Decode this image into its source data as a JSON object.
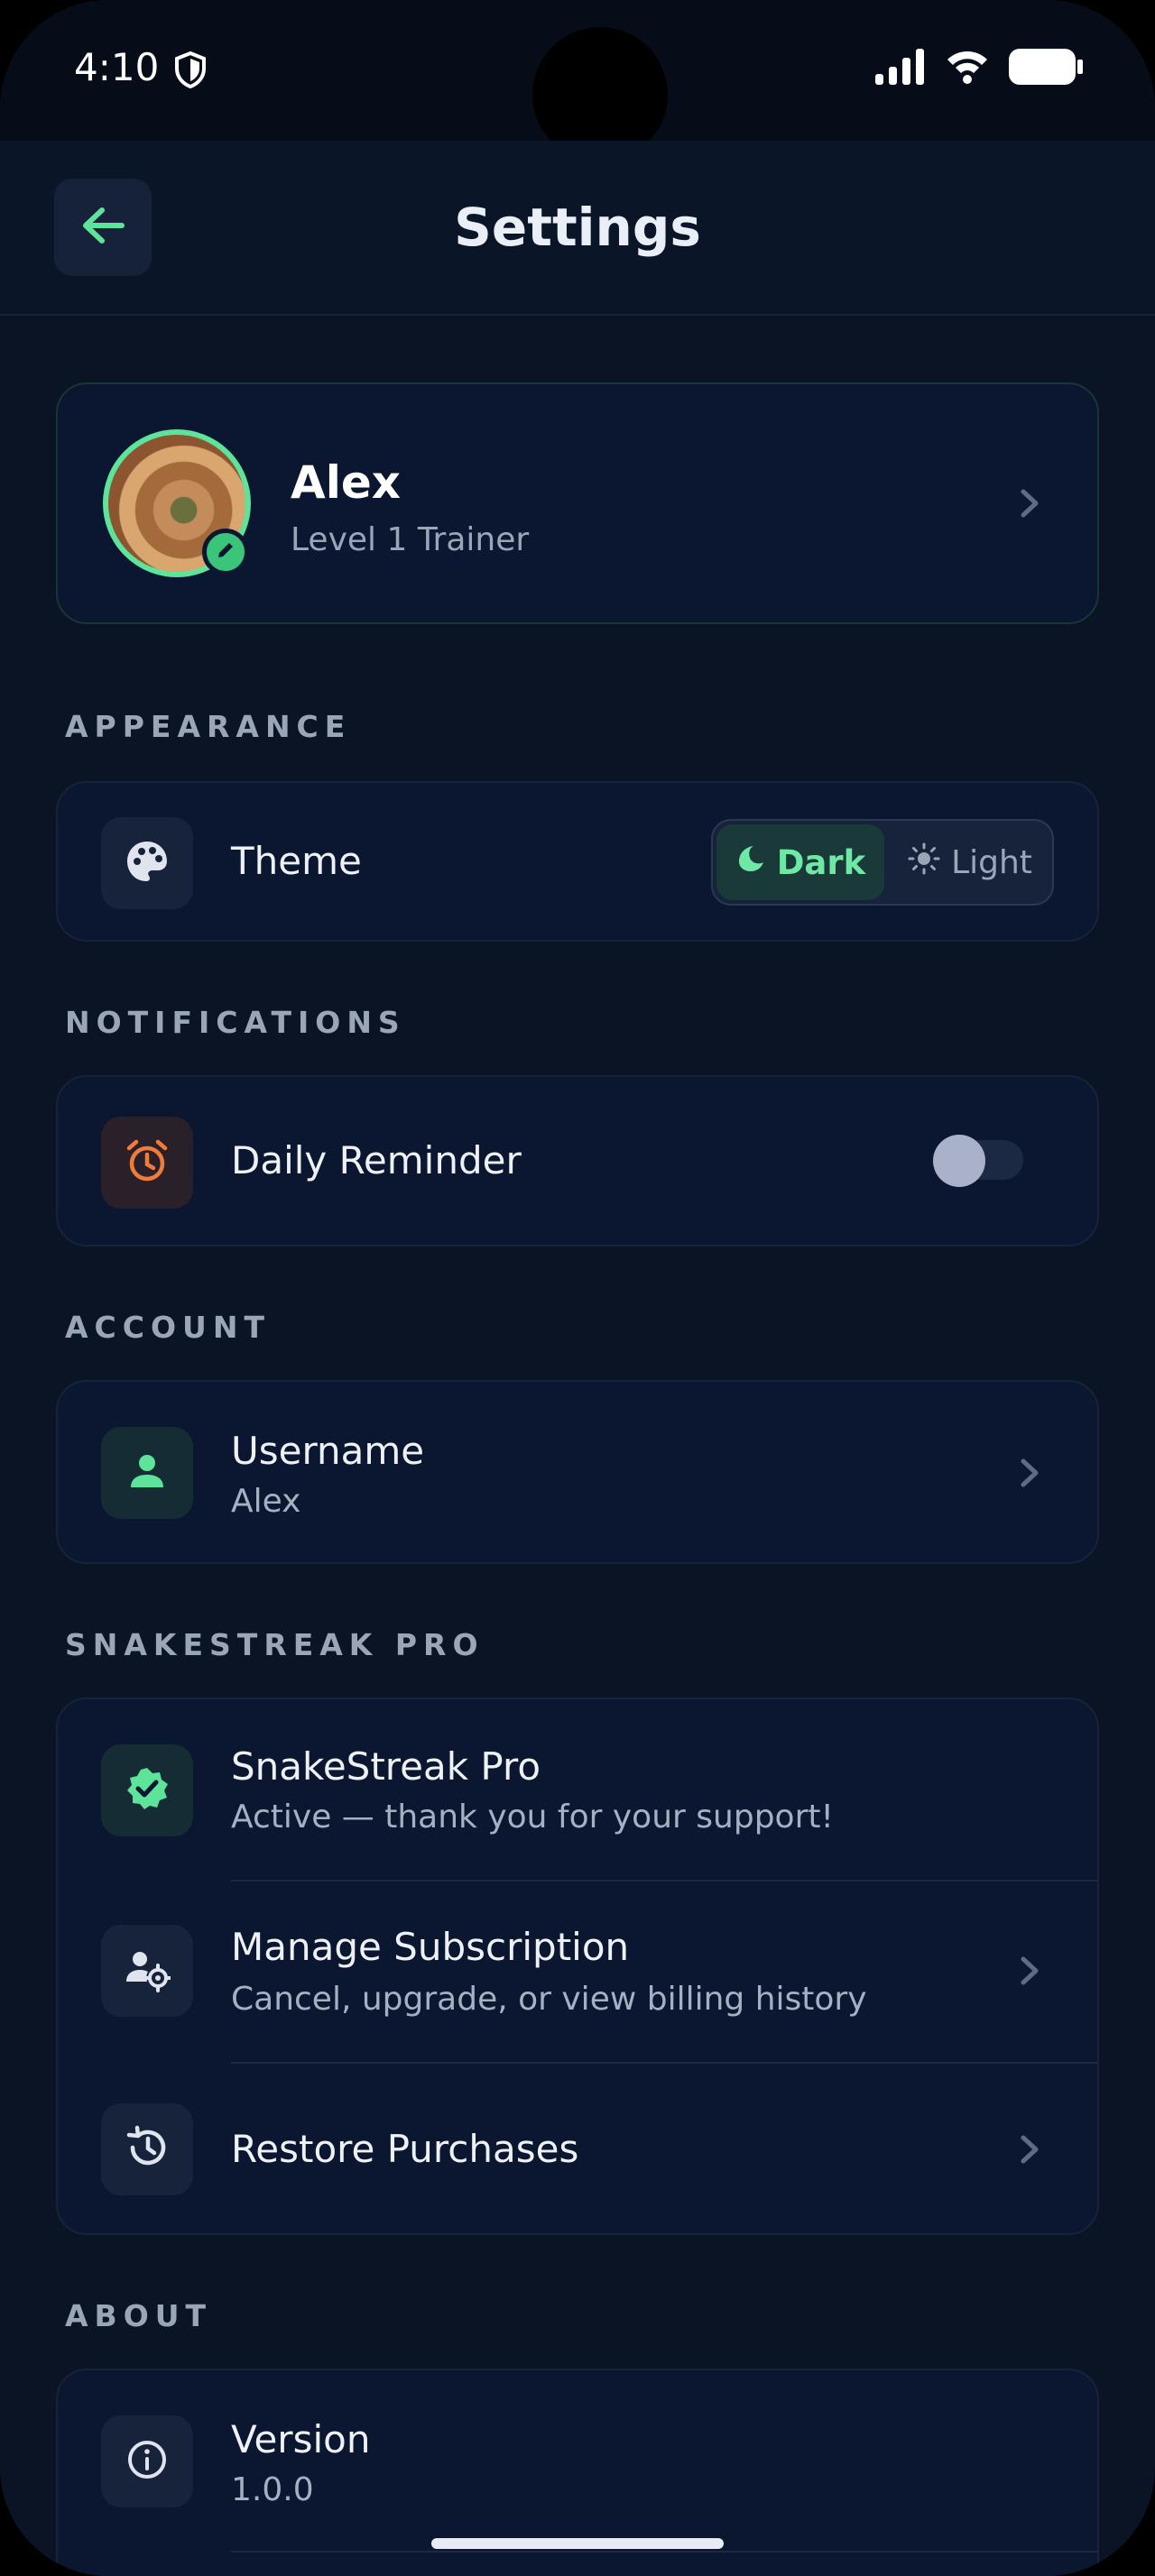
{
  "status_bar": {
    "time": "4:10"
  },
  "app_bar": {
    "title": "Settings"
  },
  "profile": {
    "name": "Alex",
    "level": "Level 1 Trainer"
  },
  "sections": {
    "appearance": "APPEARANCE",
    "notifications": "NOTIFICATIONS",
    "account": "ACCOUNT",
    "pro": "SNAKESTREAK PRO",
    "about": "ABOUT"
  },
  "appearance": {
    "theme_label": "Theme",
    "options": {
      "dark": "Dark",
      "light": "Light"
    },
    "selected": "Dark"
  },
  "notifications": {
    "daily_reminder_label": "Daily Reminder",
    "daily_reminder_on": false
  },
  "account": {
    "username_label": "Username",
    "username_value": "Alex"
  },
  "pro": {
    "status_title": "SnakeStreak Pro",
    "status_sub": "Active — thank you for your support!",
    "manage_title": "Manage Subscription",
    "manage_sub": "Cancel, upgrade, or view billing history",
    "restore_title": "Restore Purchases"
  },
  "about": {
    "version_label": "Version",
    "version_value": "1.0.0"
  },
  "colors": {
    "accent": "#5ee39a",
    "background": "#0b1424",
    "card": "#0b1730",
    "alarm": "#f07c3a"
  }
}
